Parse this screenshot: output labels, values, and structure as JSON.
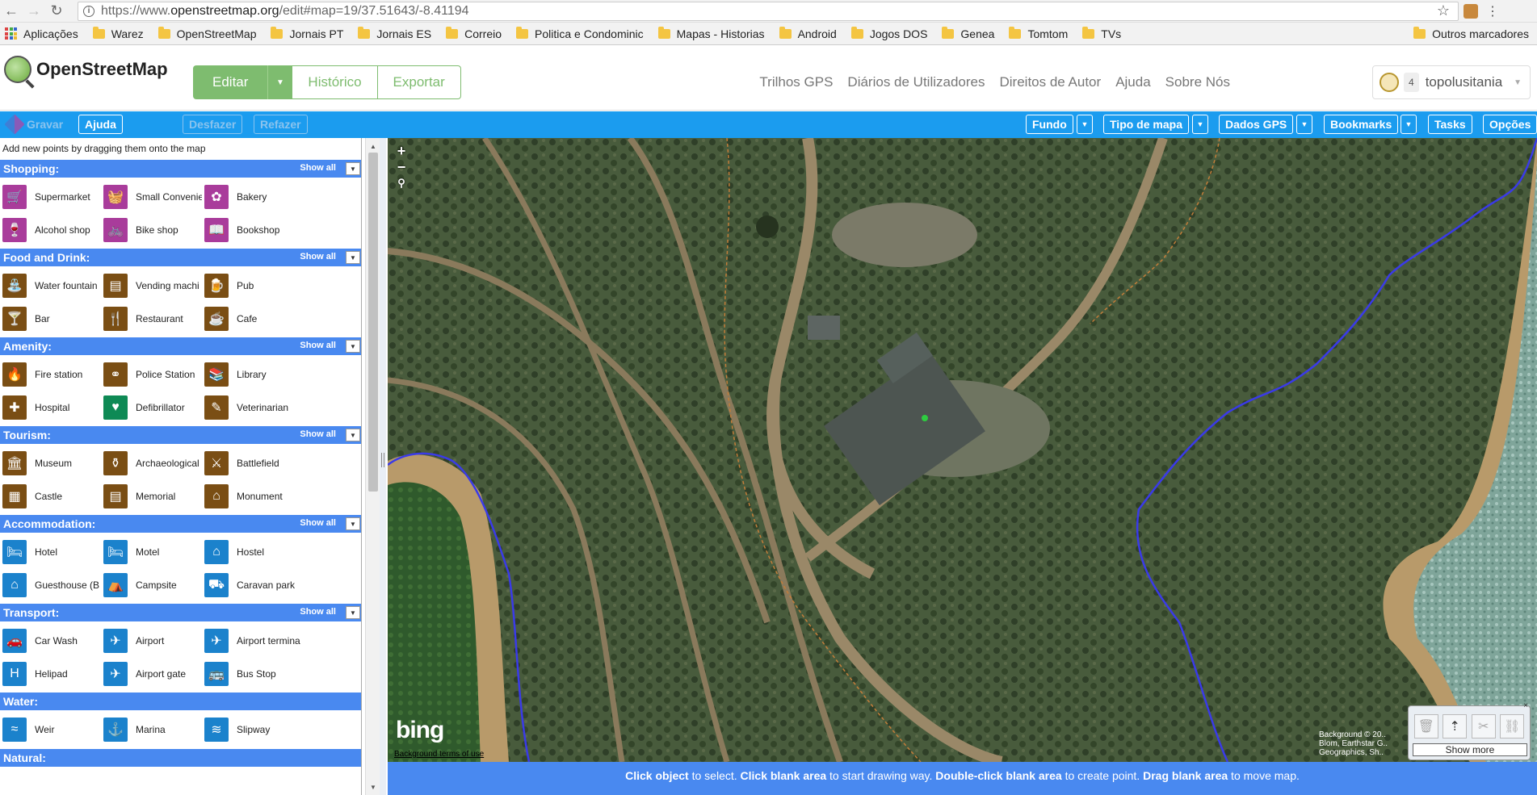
{
  "browser": {
    "url_prefix": "https://www.",
    "url_domain": "openstreetmap.org",
    "url_path": "/edit#map=19/37.51643/-8.41194"
  },
  "bookmarks": {
    "apps": "Aplicações",
    "items": [
      "Warez",
      "OpenStreetMap",
      "Jornais PT",
      "Jornais ES",
      "Correio",
      "Politica e Condominic",
      "Mapas - Historias",
      "Android",
      "Jogos DOS",
      "Genea",
      "Tomtom",
      "TVs"
    ],
    "other": "Outros marcadores"
  },
  "header": {
    "brand": "OpenStreetMap",
    "edit": "Editar",
    "history": "Histórico",
    "export": "Exportar",
    "nav": [
      "Trilhos GPS",
      "Diários de Utilizadores",
      "Direitos de Autor",
      "Ajuda",
      "Sobre Nós"
    ],
    "user_count": "4",
    "username": "topolusitania"
  },
  "toolbar": {
    "save": "Gravar",
    "help": "Ajuda",
    "undo": "Desfazer",
    "redo": "Refazer",
    "background": "Fundo",
    "map_type": "Tipo de mapa",
    "gps_data": "Dados GPS",
    "bookmarks": "Bookmarks",
    "tasks": "Tasks",
    "options": "Opções"
  },
  "panel": {
    "hint": "Add new points by dragging them onto the map",
    "show_all": "Show all",
    "sections": [
      {
        "title": "Shopping:",
        "items": [
          "Supermarket",
          "Small Convenie",
          "Bakery",
          "Alcohol shop",
          "Bike shop",
          "Bookshop"
        ]
      },
      {
        "title": "Food and Drink:",
        "items": [
          "Water fountain",
          "Vending machi",
          "Pub",
          "Bar",
          "Restaurant",
          "Cafe"
        ]
      },
      {
        "title": "Amenity:",
        "items": [
          "Fire station",
          "Police Station",
          "Library",
          "Hospital",
          "Defibrillator",
          "Veterinarian"
        ]
      },
      {
        "title": "Tourism:",
        "items": [
          "Museum",
          "Archaeological",
          "Battlefield",
          "Castle",
          "Memorial",
          "Monument"
        ]
      },
      {
        "title": "Accommodation:",
        "items": [
          "Hotel",
          "Motel",
          "Hostel",
          "Guesthouse (B",
          "Campsite",
          "Caravan park"
        ]
      },
      {
        "title": "Transport:",
        "items": [
          "Car Wash",
          "Airport",
          "Airport termina",
          "Helipad",
          "Airport gate",
          "Bus Stop"
        ]
      },
      {
        "title": "Water:",
        "items": [
          "Weir",
          "Marina",
          "Slipway"
        ]
      },
      {
        "title": "Natural:",
        "items": []
      }
    ]
  },
  "map": {
    "zoom_in": "+",
    "zoom_out": "−",
    "bing": "bing",
    "terms": "Background terms of use",
    "attribution": "Background © 20.. Blom, Earthstar G.. Geographics, Sh..",
    "show_more": "Show more"
  },
  "status": {
    "p1b": "Click object",
    "p1": " to select. ",
    "p2b": "Click blank area",
    "p2": " to start drawing way. ",
    "p3b": "Double-click blank area",
    "p3": " to create point. ",
    "p4b": "Drag blank area",
    "p4": " to move map."
  },
  "colors": {
    "osm_green": "#7ebc6f",
    "toolbar_blue": "#1b9cef",
    "section_blue": "#4989f0"
  }
}
